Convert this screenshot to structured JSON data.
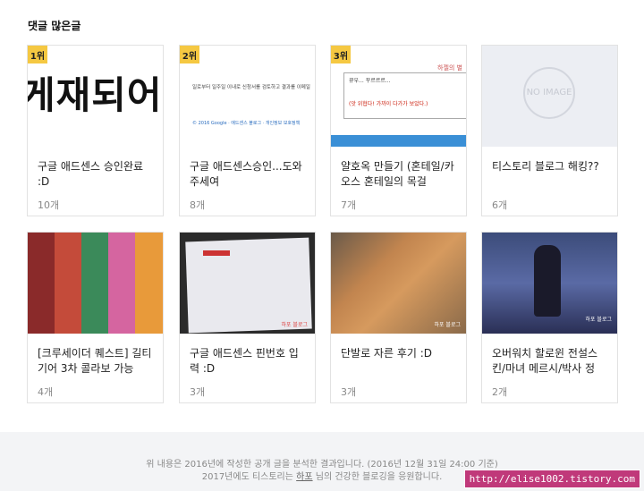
{
  "section_title": "댓글 많은글",
  "cards": [
    {
      "rank": "1위",
      "title": "구글 애드센스 승인완료 :D",
      "count": "10개",
      "thumb_text": "게재되어"
    },
    {
      "rank": "2위",
      "title": "구글 애드센스승인...도와주세여",
      "count": "8개",
      "thumb_text_1": "일로부터 일주일 이내로 신청서를 검토하고 결과를 이메일",
      "thumb_text_2": "© 2016 Google · 애드센스 블로그 · 개인정보 보호정책"
    },
    {
      "rank": "3위",
      "title": "얄호옥 만들기 (혼테일/카오스 혼테일의 목걸",
      "count": "7개",
      "thumb_text_1": "뀨우... 꾸르르르...",
      "thumb_text_2": "(앗 위협다! 가까이 다가가 보았다.)",
      "thumb_tag": "하젤의 별"
    },
    {
      "rank": "",
      "title": "티스토리 블로그 해킹??",
      "count": "6개",
      "thumb_noimg": "NO IMAGE"
    },
    {
      "rank": "",
      "title": "[크루세이더 퀘스트] 길티기어 3차 콜라보 가능",
      "count": "4개"
    },
    {
      "rank": "",
      "title": "구글 애드센스 핀번호 입력 :D",
      "count": "3개",
      "thumb_wm": "하포 블로그"
    },
    {
      "rank": "",
      "title": "단발로 자른 후기 :D",
      "count": "3개",
      "thumb_wm": "하포 블로그"
    },
    {
      "rank": "",
      "title": "오버워치 할로윈 전설스킨/마녀 메르시/박사 정",
      "count": "2개",
      "thumb_wm": "하포 블로그"
    }
  ],
  "footer": {
    "line1": "위 내용은 2016년에 작성한 공개 글을 분석한 결과입니다. (2016년 12월 31일 24:00 기준)",
    "line2_pre": "2017년에도 티스토리는 ",
    "line2_link": "하포",
    "line2_post": " 님의 건강한 블로깅을 응원합니다."
  },
  "watermark": "http://elise1002.tistory.com",
  "colors": {
    "rank_badge": "#f5c842",
    "footer_bg": "#f3f4f6",
    "watermark_bg": "#c0397a"
  }
}
